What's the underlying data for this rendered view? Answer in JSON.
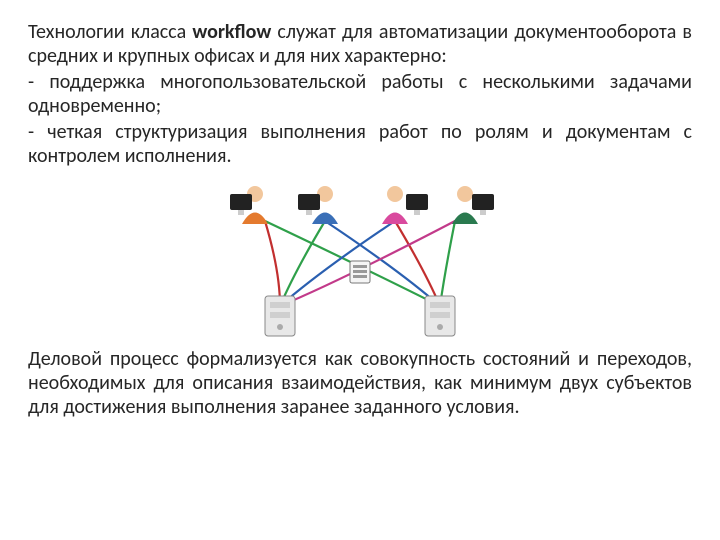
{
  "text": {
    "p1_pre": "Технологии класса ",
    "p1_bold": "workflow",
    "p1_post": " служат для автоматизации документооборота в средних и крупных офисах и для них характерно:",
    "bullet1": "- поддержка многопользовательской работы с несколькими задачами одновременно;",
    "bullet2": "- четкая структуризация выполнения работ по ролям и документам с контролем исполнения.",
    "p2": "Деловой процесс формализуется как совокупность состояний и переходов, необходимых для описания взаимодействия, как минимум двух субъектов для достижения выполнения заранее заданного условия."
  },
  "diagram": {
    "people_colors": [
      "#e47a2e",
      "#3a6fb7",
      "#d94a9e",
      "#2a7a4f"
    ],
    "server_fill": "#e8e8e8",
    "server_stroke": "#888",
    "monitor_fill": "#222",
    "monitor_stand": "#ccc",
    "arrow_green": "#2fa04a",
    "arrow_blue": "#2a5fb0",
    "arrow_red": "#c22f2f",
    "arrow_magenta": "#c23a8a"
  }
}
